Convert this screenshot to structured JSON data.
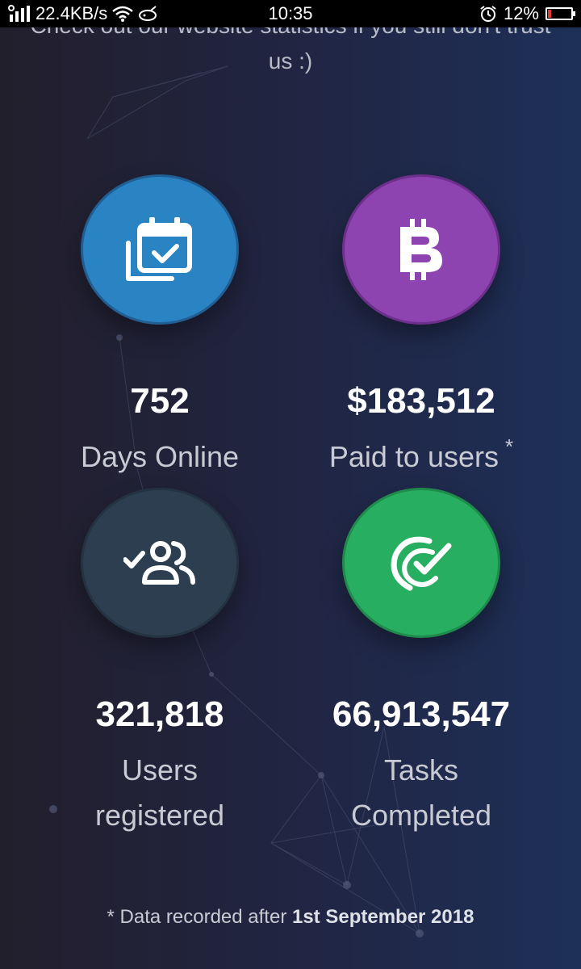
{
  "status_bar": {
    "network_speed": "22.4KB/s",
    "time": "10:35",
    "battery_percent": "12%"
  },
  "intro": {
    "text_line1": "Check out our website statistics if you still don't trust",
    "text_line2": "us :)"
  },
  "stats": [
    {
      "value": "752",
      "label": "Days Online",
      "icon": "calendar-check-icon",
      "color": "#2a83c3"
    },
    {
      "value": "$183,512",
      "label": "Paid to users",
      "marker": "*",
      "icon": "bitcoin-icon",
      "color": "#8e44b0"
    },
    {
      "value": "321,818",
      "label_line1": "Users",
      "label_line2": "registered",
      "icon": "users-check-icon",
      "color": "#2c3e50"
    },
    {
      "value": "66,913,547",
      "label_line1": "Tasks",
      "label_line2": "Completed",
      "icon": "task-check-icon",
      "color": "#27ae60"
    }
  ],
  "footnote": {
    "prefix": "* Data recorded after ",
    "date": "1st September 2018"
  }
}
